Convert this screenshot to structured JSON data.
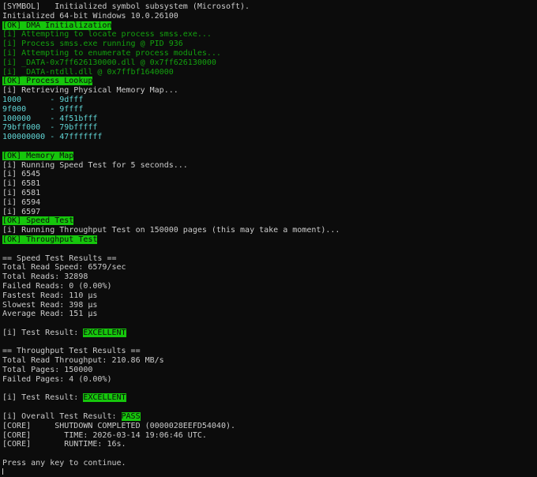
{
  "colors": {
    "background": "#0c0c0c",
    "text": "#cccccc",
    "ok_badge_bg": "#16c60c",
    "info_green": "#13a10e",
    "memory_cyan": "#61d6d6"
  },
  "lines": [
    {
      "type": "plain",
      "text": "[SYMBOL]   Initialized symbol subsystem (Microsoft)."
    },
    {
      "type": "plain",
      "text": "Initialized 64-bit Windows 10.0.26100"
    },
    {
      "type": "ok",
      "text": "[OK] DMA Initialization"
    },
    {
      "type": "info-green",
      "text": "[i] Attempting to locate process smss.exe..."
    },
    {
      "type": "info-green",
      "text": "[i] Process smss.exe running @ PID 936"
    },
    {
      "type": "info-green",
      "text": "[i] Attempting to enumerate process modules..."
    },
    {
      "type": "info-green",
      "text": "[i] _DATA-0x7ff626130000.dll @ 0x7ff626130000"
    },
    {
      "type": "info-green",
      "text": "[i] _DATA-ntdll.dll @ 0x7ffbf1640000"
    },
    {
      "type": "ok",
      "text": "[OK] Process Lookup"
    },
    {
      "type": "plain",
      "text": "[i] Retrieving Physical Memory Map..."
    },
    {
      "type": "memmap",
      "text": "1000      - 9dfff"
    },
    {
      "type": "memmap",
      "text": "9f000     - 9ffff"
    },
    {
      "type": "memmap",
      "text": "100000    - 4f51bfff"
    },
    {
      "type": "memmap",
      "text": "79bff000  - 79bfffff"
    },
    {
      "type": "memmap",
      "text": "100000000 - 47fffffff"
    },
    {
      "type": "blank",
      "text": ""
    },
    {
      "type": "ok",
      "text": "[OK] Memory Map"
    },
    {
      "type": "plain",
      "text": "[i] Running Speed Test for 5 seconds..."
    },
    {
      "type": "plain",
      "text": "[i] 6545"
    },
    {
      "type": "plain",
      "text": "[i] 6581"
    },
    {
      "type": "plain",
      "text": "[i] 6581"
    },
    {
      "type": "plain",
      "text": "[i] 6594"
    },
    {
      "type": "plain",
      "text": "[i] 6597"
    },
    {
      "type": "ok",
      "text": "[OK] Speed Test"
    },
    {
      "type": "plain",
      "text": "[i] Running Throughput Test on 150000 pages (this may take a moment)..."
    },
    {
      "type": "ok",
      "text": "[OK] Throughput Test"
    },
    {
      "type": "blank",
      "text": ""
    },
    {
      "type": "plain",
      "text": "== Speed Test Results =="
    },
    {
      "type": "plain",
      "text": "Total Read Speed: 6579/sec"
    },
    {
      "type": "plain",
      "text": "Total Reads: 32898"
    },
    {
      "type": "plain",
      "text": "Failed Reads: 0 (0.00%)"
    },
    {
      "type": "plain",
      "text": "Fastest Read: 110 µs"
    },
    {
      "type": "plain",
      "text": "Slowest Read: 398 µs"
    },
    {
      "type": "plain",
      "text": "Average Read: 151 µs"
    },
    {
      "type": "blank",
      "text": ""
    },
    {
      "type": "result",
      "prefix": "[i] Test Result: ",
      "badge": "EXCELLENT"
    },
    {
      "type": "blank",
      "text": ""
    },
    {
      "type": "plain",
      "text": "== Throughput Test Results =="
    },
    {
      "type": "plain",
      "text": "Total Read Throughput: 210.86 MB/s"
    },
    {
      "type": "plain",
      "text": "Total Pages: 150000"
    },
    {
      "type": "plain",
      "text": "Failed Pages: 4 (0.00%)"
    },
    {
      "type": "blank",
      "text": ""
    },
    {
      "type": "result",
      "prefix": "[i] Test Result: ",
      "badge": "EXCELLENT"
    },
    {
      "type": "blank",
      "text": ""
    },
    {
      "type": "result",
      "prefix": "[i] Overall Test Result: ",
      "badge": "PASS"
    },
    {
      "type": "plain",
      "text": "[CORE]     SHUTDOWN COMPLETED (0000028EEFD54040)."
    },
    {
      "type": "plain",
      "text": "[CORE]       TIME: 2026-03-14 19:06:46 UTC."
    },
    {
      "type": "plain",
      "text": "[CORE]       RUNTIME: 16s."
    },
    {
      "type": "blank",
      "text": ""
    },
    {
      "type": "plain",
      "text": "Press any key to continue."
    },
    {
      "type": "cursor",
      "text": ""
    }
  ]
}
